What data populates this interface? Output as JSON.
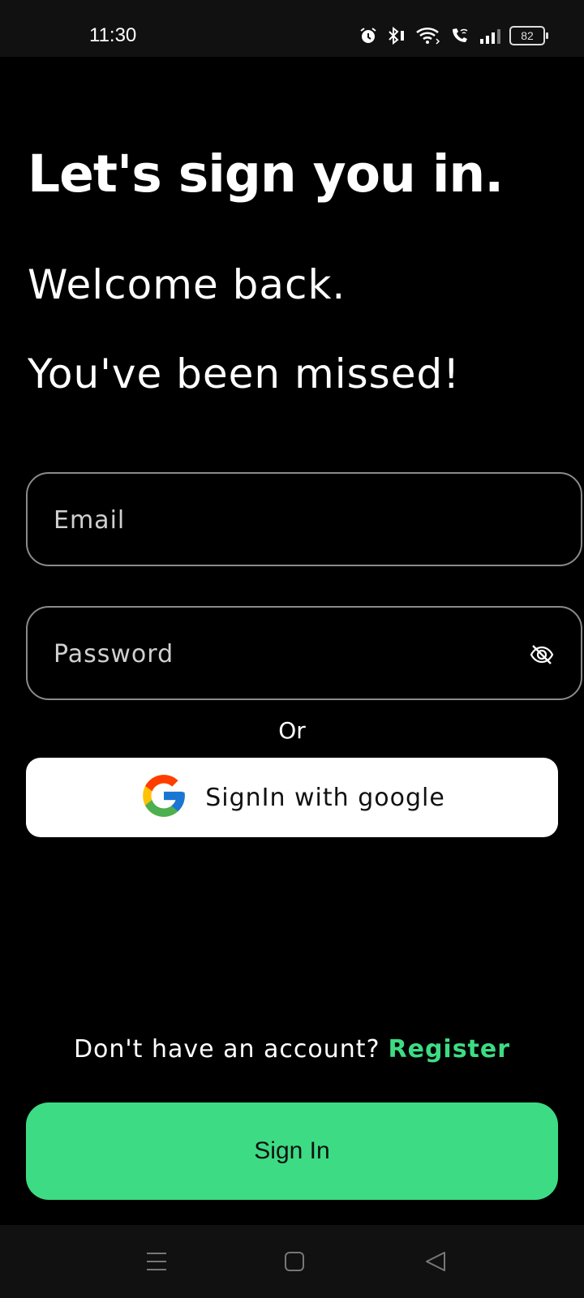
{
  "status_bar": {
    "time": "11:30",
    "battery": "82",
    "icons": [
      "alarm-icon",
      "bluetooth-icon",
      "wifi-icon",
      "wifi-calling-icon",
      "signal-icon",
      "battery-icon"
    ]
  },
  "heading": {
    "title": "Let's sign you in.",
    "line1": "Welcome back.",
    "line2": "You've been missed!"
  },
  "form": {
    "email_placeholder": "Email",
    "email_value": "",
    "password_placeholder": "Password",
    "password_value": "",
    "password_toggle_icon": "eye-off-icon"
  },
  "divider_text": "Or",
  "google_button": {
    "label": "SignIn with google",
    "icon": "google-logo-icon"
  },
  "register": {
    "prompt": "Don't have an account?",
    "link": "Register"
  },
  "signin_button": {
    "label": "Sign In"
  },
  "nav_bar": {
    "icons": [
      "menu-icon",
      "home-icon",
      "back-icon"
    ]
  },
  "colors": {
    "accent": "#3ddc84",
    "background": "#000000",
    "field_border": "#8a8a8a"
  }
}
